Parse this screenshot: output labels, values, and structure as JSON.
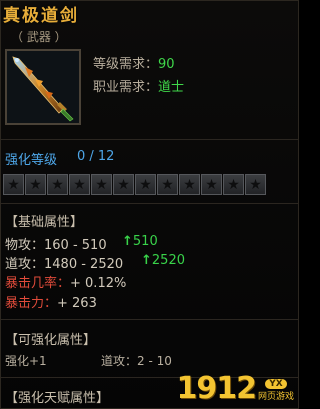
{
  "item": {
    "name": "真极道剑",
    "type_label": "（ 武器 ）",
    "requirements": [
      {
        "label": "等级需求：",
        "value": "90"
      },
      {
        "label": "职业需求：",
        "value": "道士"
      }
    ]
  },
  "enhance": {
    "label": "强化等级",
    "current": "0 / 12",
    "max_stars": 12,
    "filled_stars": 0
  },
  "base_attributes": {
    "header": "【基础属性】",
    "lines": [
      {
        "label": "物攻：",
        "value": "160 - 510",
        "bonus": "510"
      },
      {
        "label": "道攻：",
        "value": "1480 - 2520",
        "bonus": "2520"
      },
      {
        "label": "暴击几率：",
        "value": "+ 0.12%",
        "bonus": ""
      },
      {
        "label": "暴击力：",
        "value": "+ 263",
        "bonus": ""
      }
    ]
  },
  "enhanceable": {
    "header": "【可强化属性】",
    "left": "强化+1",
    "right": "道攻：2 - 10"
  },
  "talent": {
    "header": "【强化天赋属性】"
  },
  "watermark": {
    "number": "1912",
    "badge": "YX",
    "site": "网页游戏"
  },
  "colors": {
    "title": "#e8ae3a",
    "requirement_value": "#3fd84a",
    "enhance": "#4ea6e8",
    "crit_label": "#e04b3a",
    "bonus_green": "#39d34a"
  }
}
